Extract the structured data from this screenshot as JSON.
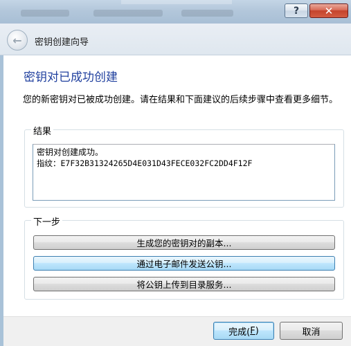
{
  "window": {
    "help_glyph": "?",
    "close_glyph": "✕"
  },
  "header": {
    "back_glyph": "←",
    "wizard_title": "密钥创建向导"
  },
  "page": {
    "heading": "密钥对已成功创建",
    "description": "您的新密钥对已被成功创建。请在结果和下面建议的后续步骤中查看更多细节。"
  },
  "results": {
    "legend": "结果",
    "line1": "密钥对创建成功。",
    "line2": "指纹：E7F32B31324265D4E031D43FECE032FC2DD4F12F"
  },
  "next_steps": {
    "legend": "下一步",
    "buttons": [
      {
        "label": "生成您的密钥对的副本..."
      },
      {
        "label": "通过电子邮件发送公钥..."
      },
      {
        "label": "将公钥上传到目录服务..."
      }
    ]
  },
  "footer": {
    "finish_label": "完成(",
    "finish_mnemonic": "F",
    "finish_suffix": ")",
    "cancel_label": "取消"
  },
  "colors": {
    "heading": "#1f3f9e",
    "close_button": "#c4432c",
    "hover_button": "#bee6fd"
  }
}
